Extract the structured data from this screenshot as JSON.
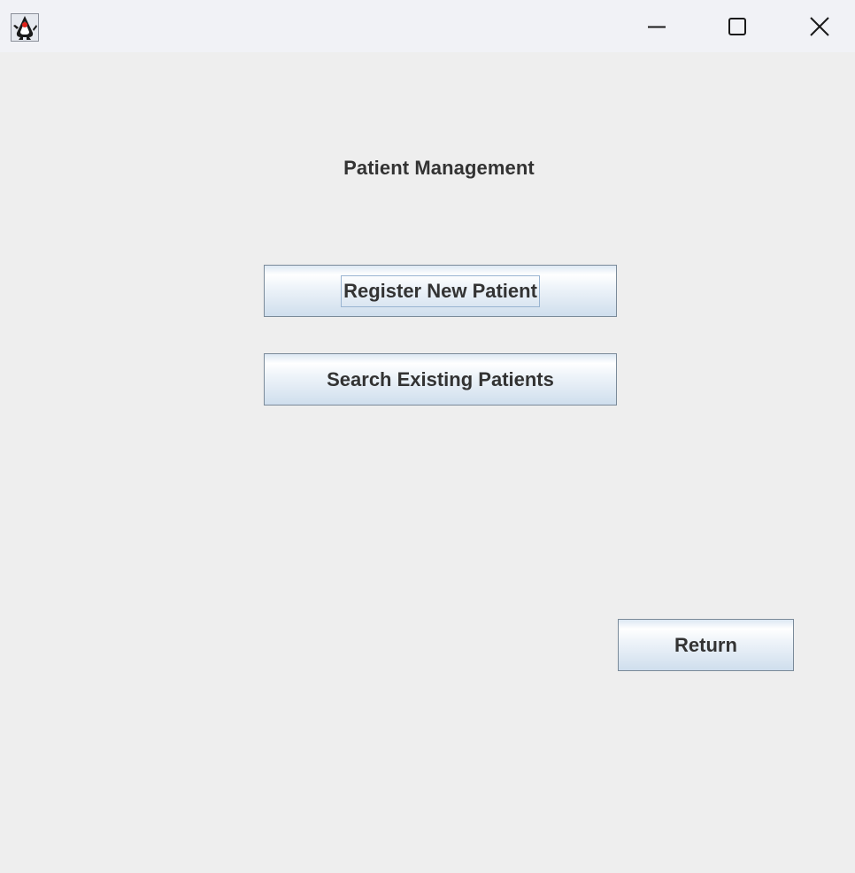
{
  "window": {
    "title_bar_icon": "java-duke-icon",
    "controls": {
      "minimize_icon": "minimize-icon",
      "maximize_icon": "maximize-icon",
      "close_icon": "close-icon"
    }
  },
  "main": {
    "title": "Patient Management",
    "register_button_label": "Register New Patient",
    "search_button_label": "Search Existing Patients",
    "return_button_label": "Return"
  },
  "colors": {
    "background": "#eeeeee",
    "titlebar": "#f1f2f6",
    "text": "#333333",
    "button_border": "#7a8a99",
    "focus_ring": "#99b4d1"
  }
}
